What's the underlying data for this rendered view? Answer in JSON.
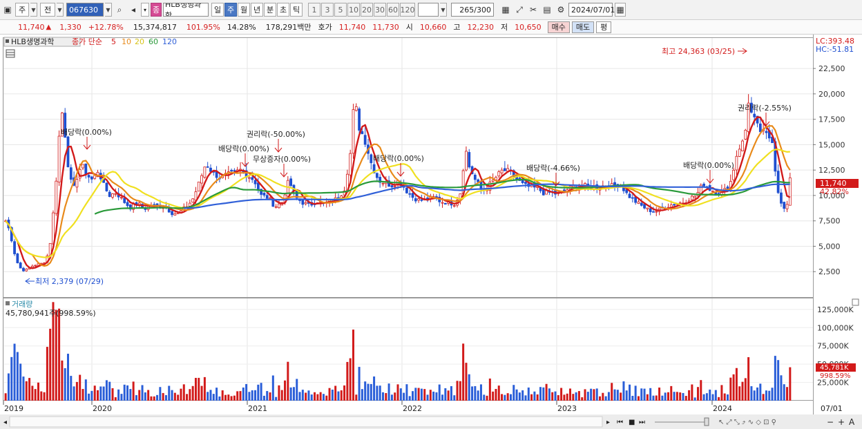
{
  "toolbar": {
    "period_type": "주",
    "market": "전",
    "code": "067630",
    "stock_name": "HLB생명과학",
    "name_icon": "종",
    "tabs": [
      "일",
      "주",
      "월",
      "년",
      "분",
      "초",
      "틱"
    ],
    "active_tab": "주",
    "nums": [
      "1",
      "3",
      "5",
      "10",
      "20",
      "30",
      "60",
      "120"
    ],
    "count": "265",
    "count_total": "/300",
    "date": "2024/07/01"
  },
  "quote": {
    "price": "11,740",
    "dir_icon": "up-triangle",
    "change": "1,330",
    "rate": "+12.78%",
    "volume": "15,374,817",
    "vol_ratio": "101.95%",
    "turnover": "14.28%",
    "amount": "178,291백만",
    "hoga_label": "호가",
    "ask": "11,740",
    "bid": "11,730",
    "open_label": "시",
    "open": "10,660",
    "high_label": "고",
    "high": "12,230",
    "low_label": "저",
    "low": "10,650",
    "buy_label": "매수",
    "sell_label": "매도",
    "flat_label": "평"
  },
  "legend": {
    "title": "HLB생명과학",
    "label": "종가 단순",
    "periods": [
      "5",
      "10",
      "20",
      "60",
      "120"
    ]
  },
  "annotations": {
    "max": "최고 24,363 (03/25)",
    "min": "최저 2,379 (07/29)",
    "events": [
      "배당락(0.00%)",
      "배당락(0.00%)",
      "권리락(-50.00%)",
      "무상증자(0.00%)",
      "배당락(0.00%)",
      "배당락(-4.66%)",
      "배당락(0.00%)",
      "권리락(-2.55%)"
    ]
  },
  "right_top": {
    "lc": "LC:393.48",
    "hc": "HC:-51.81"
  },
  "price_badge": {
    "price": "11,740",
    "pct": "42.82%"
  },
  "volume_panel": {
    "title": "거래량",
    "stat": "45,780,941주(998.59%)",
    "badge": "45,781K",
    "badge_pct": "998.59%"
  },
  "chart_data": {
    "type": "candlestick",
    "interval": "weekly",
    "y_axis_ticks": [
      "22,500",
      "20,000",
      "17,500",
      "15,000",
      "12,500",
      "10,000",
      "7,500",
      "5,000",
      "2,500"
    ],
    "ylim": [
      0,
      25500
    ],
    "volume_ticks": [
      "125,000K",
      "100,000K",
      "75,000K",
      "50,000K",
      "25,000K"
    ],
    "volume_ylim": [
      0,
      140000
    ],
    "x_axis_ticks": [
      "2019",
      "2020",
      "2021",
      "2022",
      "2023",
      "2024",
      "07/01"
    ],
    "close_path": {
      "x": [
        0,
        6,
        12,
        18,
        24,
        30,
        36,
        45,
        52,
        58,
        64,
        70,
        76,
        80,
        86,
        92,
        98,
        104,
        110,
        118,
        126,
        134,
        142,
        150,
        160,
        170,
        180,
        190,
        200,
        210,
        220,
        230,
        240,
        250,
        260,
        270,
        280,
        290,
        300,
        310,
        320,
        330,
        340,
        350,
        360,
        370,
        380,
        390,
        400,
        410,
        420,
        430,
        440,
        450,
        460,
        470,
        480,
        490,
        500,
        505,
        510,
        520,
        530,
        540,
        550,
        560,
        570,
        580,
        590,
        600,
        610,
        620,
        630,
        640,
        650,
        660,
        665,
        670,
        680,
        690,
        700,
        710,
        720,
        730,
        740,
        750,
        760,
        770,
        780,
        790,
        800,
        810,
        820,
        830,
        840,
        850,
        860,
        870,
        880,
        890,
        900,
        910,
        920,
        930,
        940,
        950,
        960,
        970,
        980,
        990,
        1000,
        1010,
        1020,
        1030,
        1040,
        1050,
        1060,
        1070,
        1075,
        1080,
        1090,
        1100,
        1110,
        1115,
        1120,
        1125,
        1130,
        1135,
        1140,
        1145
      ],
      "y": [
        7500,
        6500,
        4500,
        3200,
        2600,
        2700,
        3000,
        3200,
        3300,
        3500,
        5000,
        9000,
        14000,
        19000,
        16000,
        12000,
        10500,
        12000,
        13000,
        12000,
        11500,
        12500,
        11000,
        10000,
        10300,
        9500,
        8800,
        9300,
        8700,
        9100,
        8900,
        9000,
        8300,
        8200,
        8800,
        9500,
        11200,
        13200,
        12200,
        11800,
        12000,
        12200,
        12500,
        12000,
        11500,
        10000,
        9800,
        8900,
        9300,
        11500,
        9800,
        9300,
        9000,
        9500,
        9200,
        9400,
        9700,
        10500,
        14500,
        20000,
        17000,
        15500,
        13000,
        11500,
        11200,
        11000,
        11500,
        10500,
        9800,
        9500,
        9600,
        9800,
        9400,
        9300,
        9200,
        10500,
        15000,
        13000,
        11500,
        10500,
        11000,
        11800,
        12500,
        12300,
        11600,
        11000,
        10800,
        10700,
        10200,
        10300,
        10100,
        10500,
        10800,
        11000,
        10900,
        10800,
        10900,
        11000,
        10900,
        11100,
        10100,
        9500,
        9000,
        8600,
        8400,
        8700,
        9000,
        9200,
        9300,
        9700,
        10000,
        11200,
        10600,
        10300,
        10400,
        11400,
        14500,
        15500,
        19500,
        18000,
        16500,
        16000,
        15500,
        12000,
        9800,
        8600,
        8800,
        9200,
        8500,
        11740
      ]
    },
    "ma_periods": [
      5,
      10,
      20,
      60,
      120
    ],
    "ma_colors": [
      "#d21a1a",
      "#e88a1a",
      "#f0e020",
      "#2a9a3a",
      "#3060d8"
    ]
  }
}
